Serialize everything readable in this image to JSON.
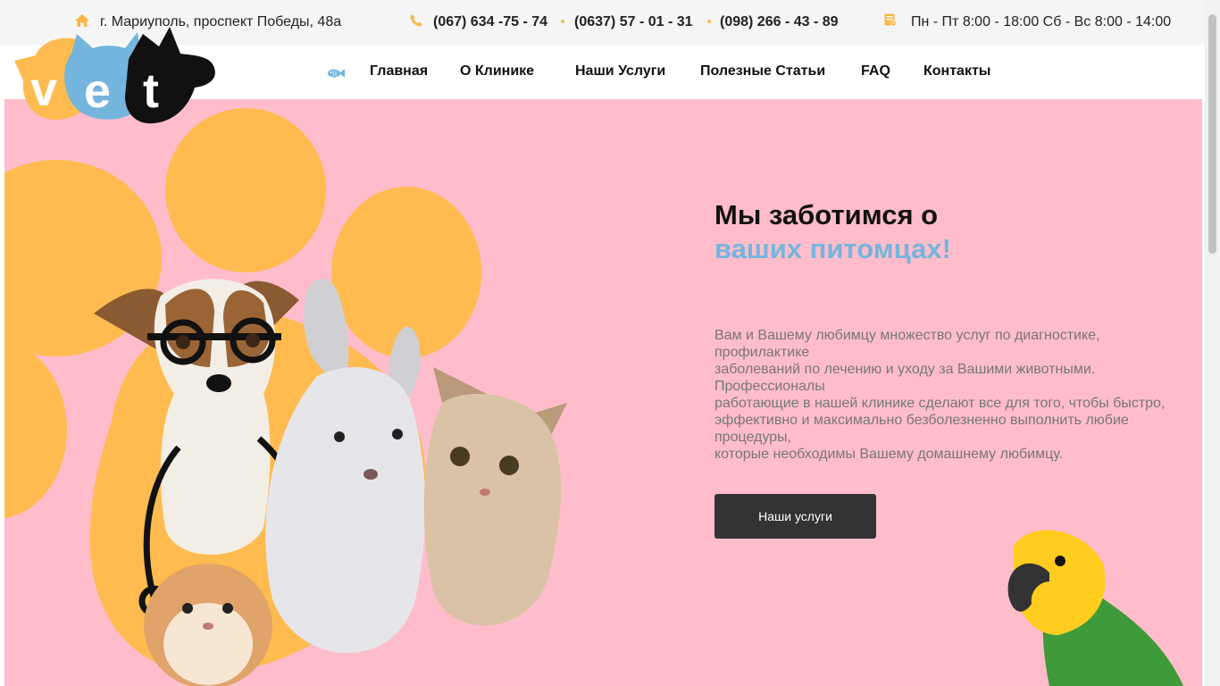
{
  "topbar": {
    "address": "г. Мариуполь, проспект Победы, 48а",
    "phones": [
      "(067) 634 -75 - 74",
      "(0637) 57 - 01 - 31",
      "(098) 266 - 43 - 89"
    ],
    "hours": "Пн - Пт 8:00 - 18:00 Сб - Вс 8:00 - 14:00"
  },
  "logo": {
    "text": "vet"
  },
  "nav": {
    "items": [
      "Главная",
      "О Клинике",
      "Наши Услуги",
      "Полезные Статьи",
      "FAQ",
      "Контакты"
    ]
  },
  "hero": {
    "headline_line1": "Мы заботимся о",
    "headline_line2": "ваших питомцах!",
    "description": [
      "Вам и Вашему любимцу множество услуг по диагностике,",
      "профилактике",
      "заболеваний по лечению и уходу за Вашими животными.",
      "Профессионалы",
      "работающие в нашей клинике сделают все для того, чтобы быстро,",
      "эффективно и максимально безболезненно выполнить любие",
      "процедуры,",
      "которые необходимы Вашему домашнему любимцу."
    ],
    "cta_label": "Наши услуги"
  },
  "colors": {
    "accent_blue": "#74b5dd",
    "accent_yellow": "#f7b745",
    "hero_pink": "#ffbdcb",
    "button_dark": "#333333",
    "paw_orange": "#ffbb4f"
  },
  "icons": {
    "address": "home-icon",
    "phone": "phone-icon",
    "hours": "schedule-icon",
    "nav_marker": "fish-icon"
  }
}
